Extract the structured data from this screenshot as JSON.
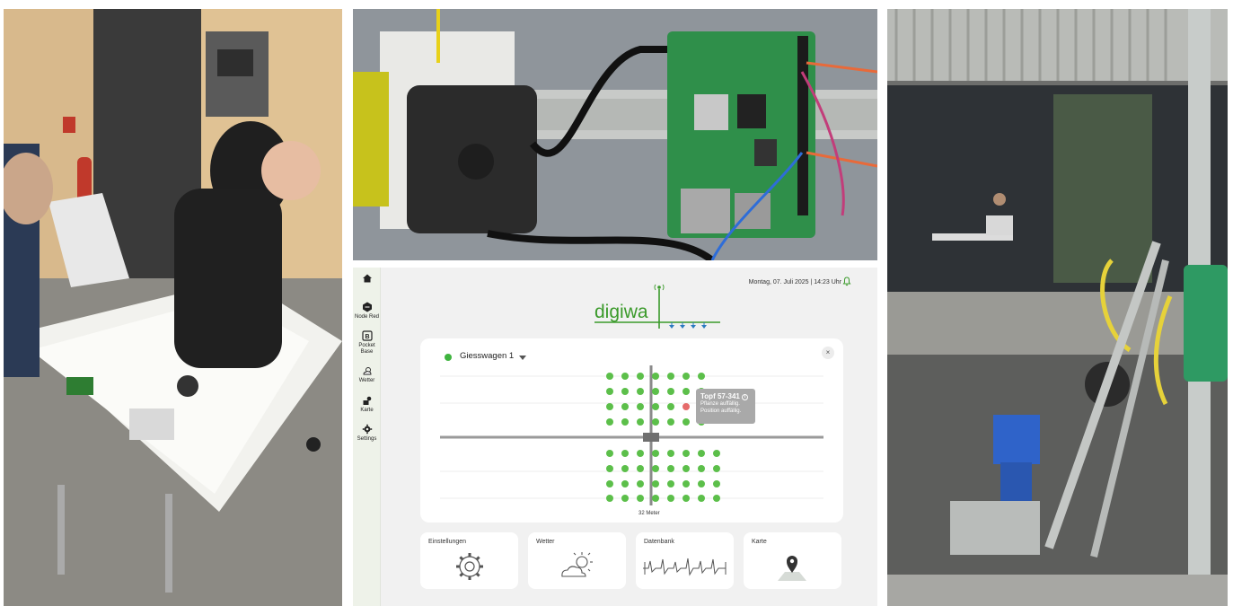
{
  "sidebar": {
    "items": [
      {
        "label": "",
        "icon": "home-icon"
      },
      {
        "label": "Node Red",
        "icon": "node-red-icon"
      },
      {
        "label": "Pocket Base",
        "icon": "pocket-base-icon"
      },
      {
        "label": "Wetter",
        "icon": "weather-icon"
      },
      {
        "label": "Karte",
        "icon": "map-icon"
      },
      {
        "label": "Settings",
        "icon": "gear-icon"
      }
    ]
  },
  "header": {
    "logo_text": "digiwa",
    "datetime": "Montag, 07. Juli 2025 | 14:23 Uhr",
    "bell_icon": "bell-icon"
  },
  "map_card": {
    "cart_label": "Giesswagen 1",
    "cart_status_color": "#3fb43f",
    "close_label": "×",
    "scale_label": "32 Meter",
    "tooltip": {
      "title": "Topf 57-341",
      "line1": "Pflanze auffällig.",
      "line2": "Position auffällig."
    },
    "plant_color_ok": "#5cbf4a",
    "plant_color_alert": "#e56a6a"
  },
  "tiles": [
    {
      "label": "Einstellungen",
      "icon": "gear-icon"
    },
    {
      "label": "Wetter",
      "icon": "weather-icon"
    },
    {
      "label": "Datenbank",
      "icon": "waveform-icon"
    },
    {
      "label": "Karte",
      "icon": "map-pin-icon"
    }
  ],
  "colors": {
    "brand_green": "#3a9a2a",
    "brand_blue": "#2a7ac0",
    "sidebar_bg": "#eef2e9"
  }
}
